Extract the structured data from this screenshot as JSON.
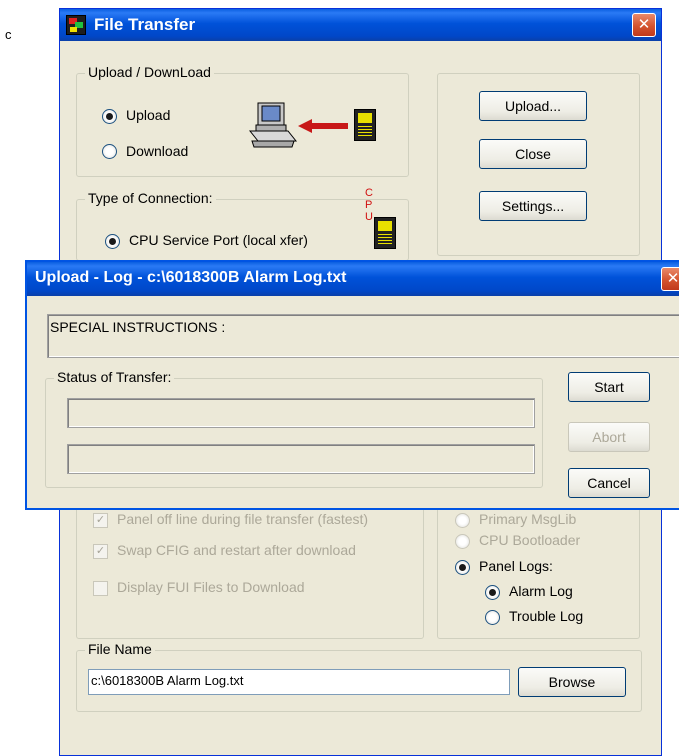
{
  "stray_text": "c",
  "file_transfer": {
    "title": "File Transfer",
    "close_glyph": "✕",
    "upload_download": {
      "legend": "Upload / DownLoad",
      "upload_label": "Upload",
      "download_label": "Download",
      "selected": "Upload"
    },
    "buttons": {
      "upload": "Upload...",
      "close": "Close",
      "settings": "Settings..."
    },
    "connection": {
      "legend": "Type of Connection:",
      "cpu_service_port": "CPU Service Port (local xfer)",
      "selected": "CPU Service Port (local xfer)",
      "cpu_icon_letters": "CPU"
    },
    "options": {
      "panel_offline": "Panel off line during file transfer (fastest)",
      "swap_cfig": "Swap CFIG and restart after download",
      "display_fui": "Display FUI Files to Download",
      "swap_cfig_checked": true,
      "display_fui_checked": false
    },
    "file_types": {
      "primary_msglib": "Primary MsgLib",
      "cpu_bootloader": "CPU Bootloader",
      "panel_logs": "Panel Logs:",
      "alarm_log": "Alarm Log",
      "trouble_log": "Trouble Log",
      "selected_type": "Panel Logs:",
      "selected_log": "Alarm Log"
    },
    "file_name": {
      "legend": "File Name",
      "value": "c:\\6018300B Alarm Log.txt",
      "browse": "Browse"
    }
  },
  "upload_log": {
    "title": "Upload - Log - c:\\6018300B Alarm Log.txt",
    "close_glyph": "✕",
    "special_instructions": "SPECIAL INSTRUCTIONS :",
    "status_legend": "Status of Transfer:",
    "status_line1": "",
    "status_line2": "",
    "buttons": {
      "start": "Start",
      "abort": "Abort",
      "cancel": "Cancel"
    }
  },
  "colors": {
    "xp_blue": "#0052d9",
    "dialog_face": "#ece9d8",
    "disabled_text": "#aca899"
  }
}
